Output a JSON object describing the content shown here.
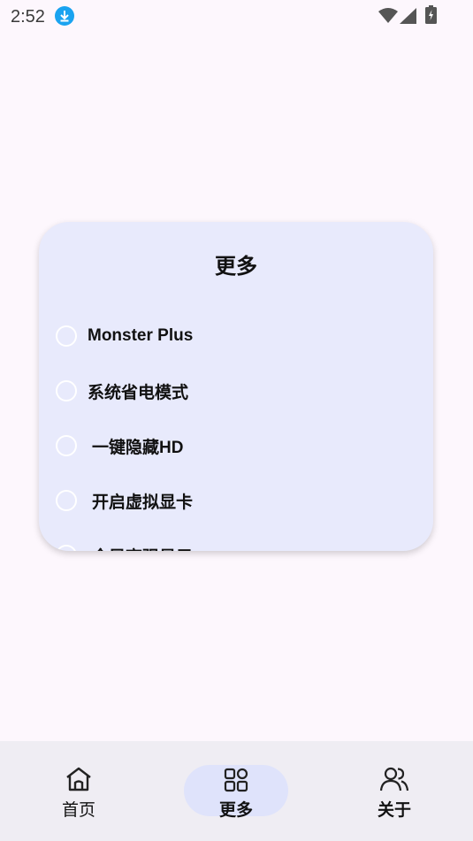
{
  "status": {
    "time": "2:52"
  },
  "dialog": {
    "title": "更多",
    "options": [
      {
        "label": "Monster Plus",
        "checked": false
      },
      {
        "label": "系统省电模式",
        "checked": false
      },
      {
        "label": "一键隐藏HD",
        "checked": false
      },
      {
        "label": "开启虚拟显卡",
        "checked": false
      },
      {
        "label": "全局高强显示",
        "checked": false
      }
    ]
  },
  "nav": {
    "items": [
      {
        "label": "首页",
        "icon": "home-icon",
        "active": false
      },
      {
        "label": "更多",
        "icon": "grid-icon",
        "active": true
      },
      {
        "label": "关于",
        "icon": "people-icon",
        "active": false
      }
    ]
  },
  "colors": {
    "background": "#fdf7fd",
    "dialog": "#e8eafc",
    "nav_bar": "#efedf3",
    "active_pill": "#dfe3fb",
    "download_badge": "#1aa3f0"
  }
}
